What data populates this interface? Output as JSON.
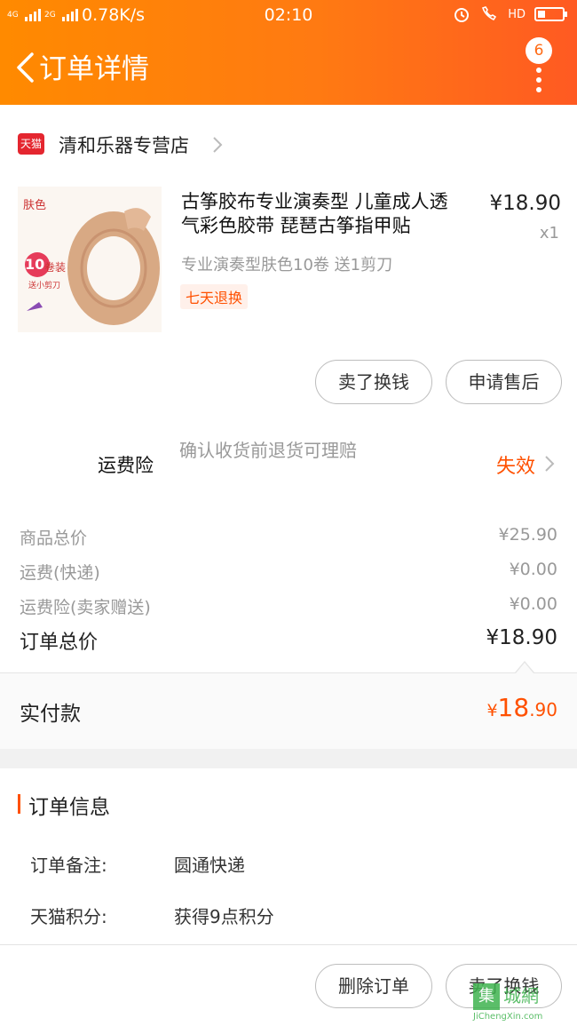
{
  "status_bar": {
    "network_1": "4G",
    "network_2": "2G",
    "speed": "0.78K/s",
    "time": "02:10",
    "hd": "HD"
  },
  "header": {
    "title": "订单详情",
    "badge_count": "6"
  },
  "store": {
    "platform_badge": "天猫",
    "name": "清和乐器专营店"
  },
  "product": {
    "title": "古筝胶布专业演奏型 儿童成人透气彩色胶带 琵琶古筝指甲贴",
    "price": "¥18.90",
    "qty": "x1",
    "spec": "专业演奏型肤色10卷 送1剪刀",
    "tag": "七天退换",
    "image_text": {
      "color_label": "肤色",
      "count": "10",
      "unit": "卷装",
      "gift": "送小剪刀"
    }
  },
  "product_actions": {
    "sell_label": "卖了换钱",
    "after_sale_label": "申请售后"
  },
  "insurance": {
    "label": "运费险",
    "desc": "确认收货前退货可理赔",
    "status": "失效"
  },
  "price_summary": {
    "items": [
      {
        "label": "商品总价",
        "value": "¥25.90"
      },
      {
        "label": "运费(快递)",
        "value": "¥0.00"
      },
      {
        "label": "运费险(卖家赠送)",
        "value": "¥0.00"
      }
    ],
    "total_label": "订单总价",
    "total_value": "¥18.90",
    "paid_label": "实付款",
    "paid_currency": "¥",
    "paid_int": "18",
    "paid_dec": ".90"
  },
  "order_info": {
    "title": "订单信息",
    "rows": [
      {
        "key": "订单备注:",
        "value": "圆通快递"
      },
      {
        "key": "天猫积分:",
        "value": "获得9点积分"
      }
    ]
  },
  "bottom_actions": {
    "delete_label": "删除订单",
    "sell_label": "卖了换钱"
  },
  "watermark": {
    "logo": "集",
    "text": "城網",
    "url": "JiChengXin.com"
  },
  "colors": {
    "header_start": "#ff8a00",
    "header_end": "#ff5a22",
    "accent": "#ff5000",
    "tmall_red": "#e4262f"
  }
}
